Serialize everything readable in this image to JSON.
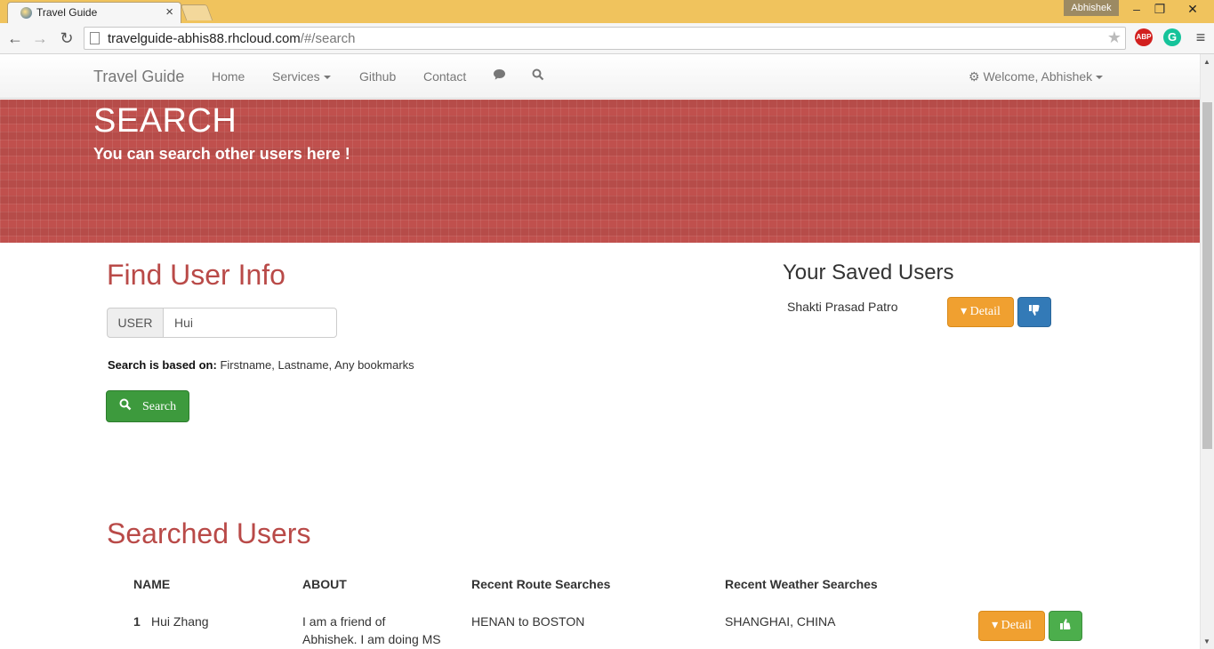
{
  "browser": {
    "tab_title": "Travel Guide",
    "profile": "Abhishek",
    "url_host": "travelguide-abhis88.rhcloud.com",
    "url_path": "/#/search",
    "abp_label": "ABP",
    "grammarly_label": "G"
  },
  "navbar": {
    "brand": "Travel Guide",
    "links": [
      "Home",
      "Services",
      "Github",
      "Contact"
    ],
    "welcome": "Welcome, Abhishek"
  },
  "hero": {
    "title": "SEARCH",
    "subtitle": "You can search other users here !"
  },
  "find": {
    "heading": "Find User Info",
    "addon": "USER",
    "value": "Hui",
    "note_label": "Search is based on:",
    "note_text": "Firstname, Lastname, Any bookmarks",
    "search_label": "Search"
  },
  "saved": {
    "heading": "Your Saved Users",
    "users": [
      {
        "name": "Shakti Prasad Patro",
        "detail_label": "Detail"
      }
    ]
  },
  "results": {
    "heading": "Searched Users",
    "columns": [
      "NAME",
      "ABOUT",
      "Recent Route Searches",
      "Recent Weather Searches"
    ],
    "rows": [
      {
        "index": "1",
        "name": "Hui Zhang",
        "about_line1": "I am a friend of",
        "about_line2": "Abhishek. I am doing MS",
        "route": "HENAN to BOSTON",
        "weather": "SHANGHAI, CHINA",
        "detail_label": "Detail"
      }
    ]
  },
  "icons": {
    "back": "arrow-left-icon",
    "forward": "arrow-right-icon",
    "reload": "reload-icon",
    "star": "star-icon",
    "menu": "hamburger-menu-icon",
    "chat": "comment-icon",
    "search": "search-icon",
    "gear": "gear-icon",
    "chevron": "chevron-circle-down-icon",
    "thumbs_down": "thumbs-down-icon",
    "thumbs_up": "thumbs-up-icon"
  },
  "colors": {
    "titlebar": "#f0c35d",
    "hero": "#c0504d",
    "heading_red": "#b94a48",
    "btn_green": "#3d9a3d",
    "btn_orange": "#f0a030",
    "btn_blue": "#337ab7"
  }
}
